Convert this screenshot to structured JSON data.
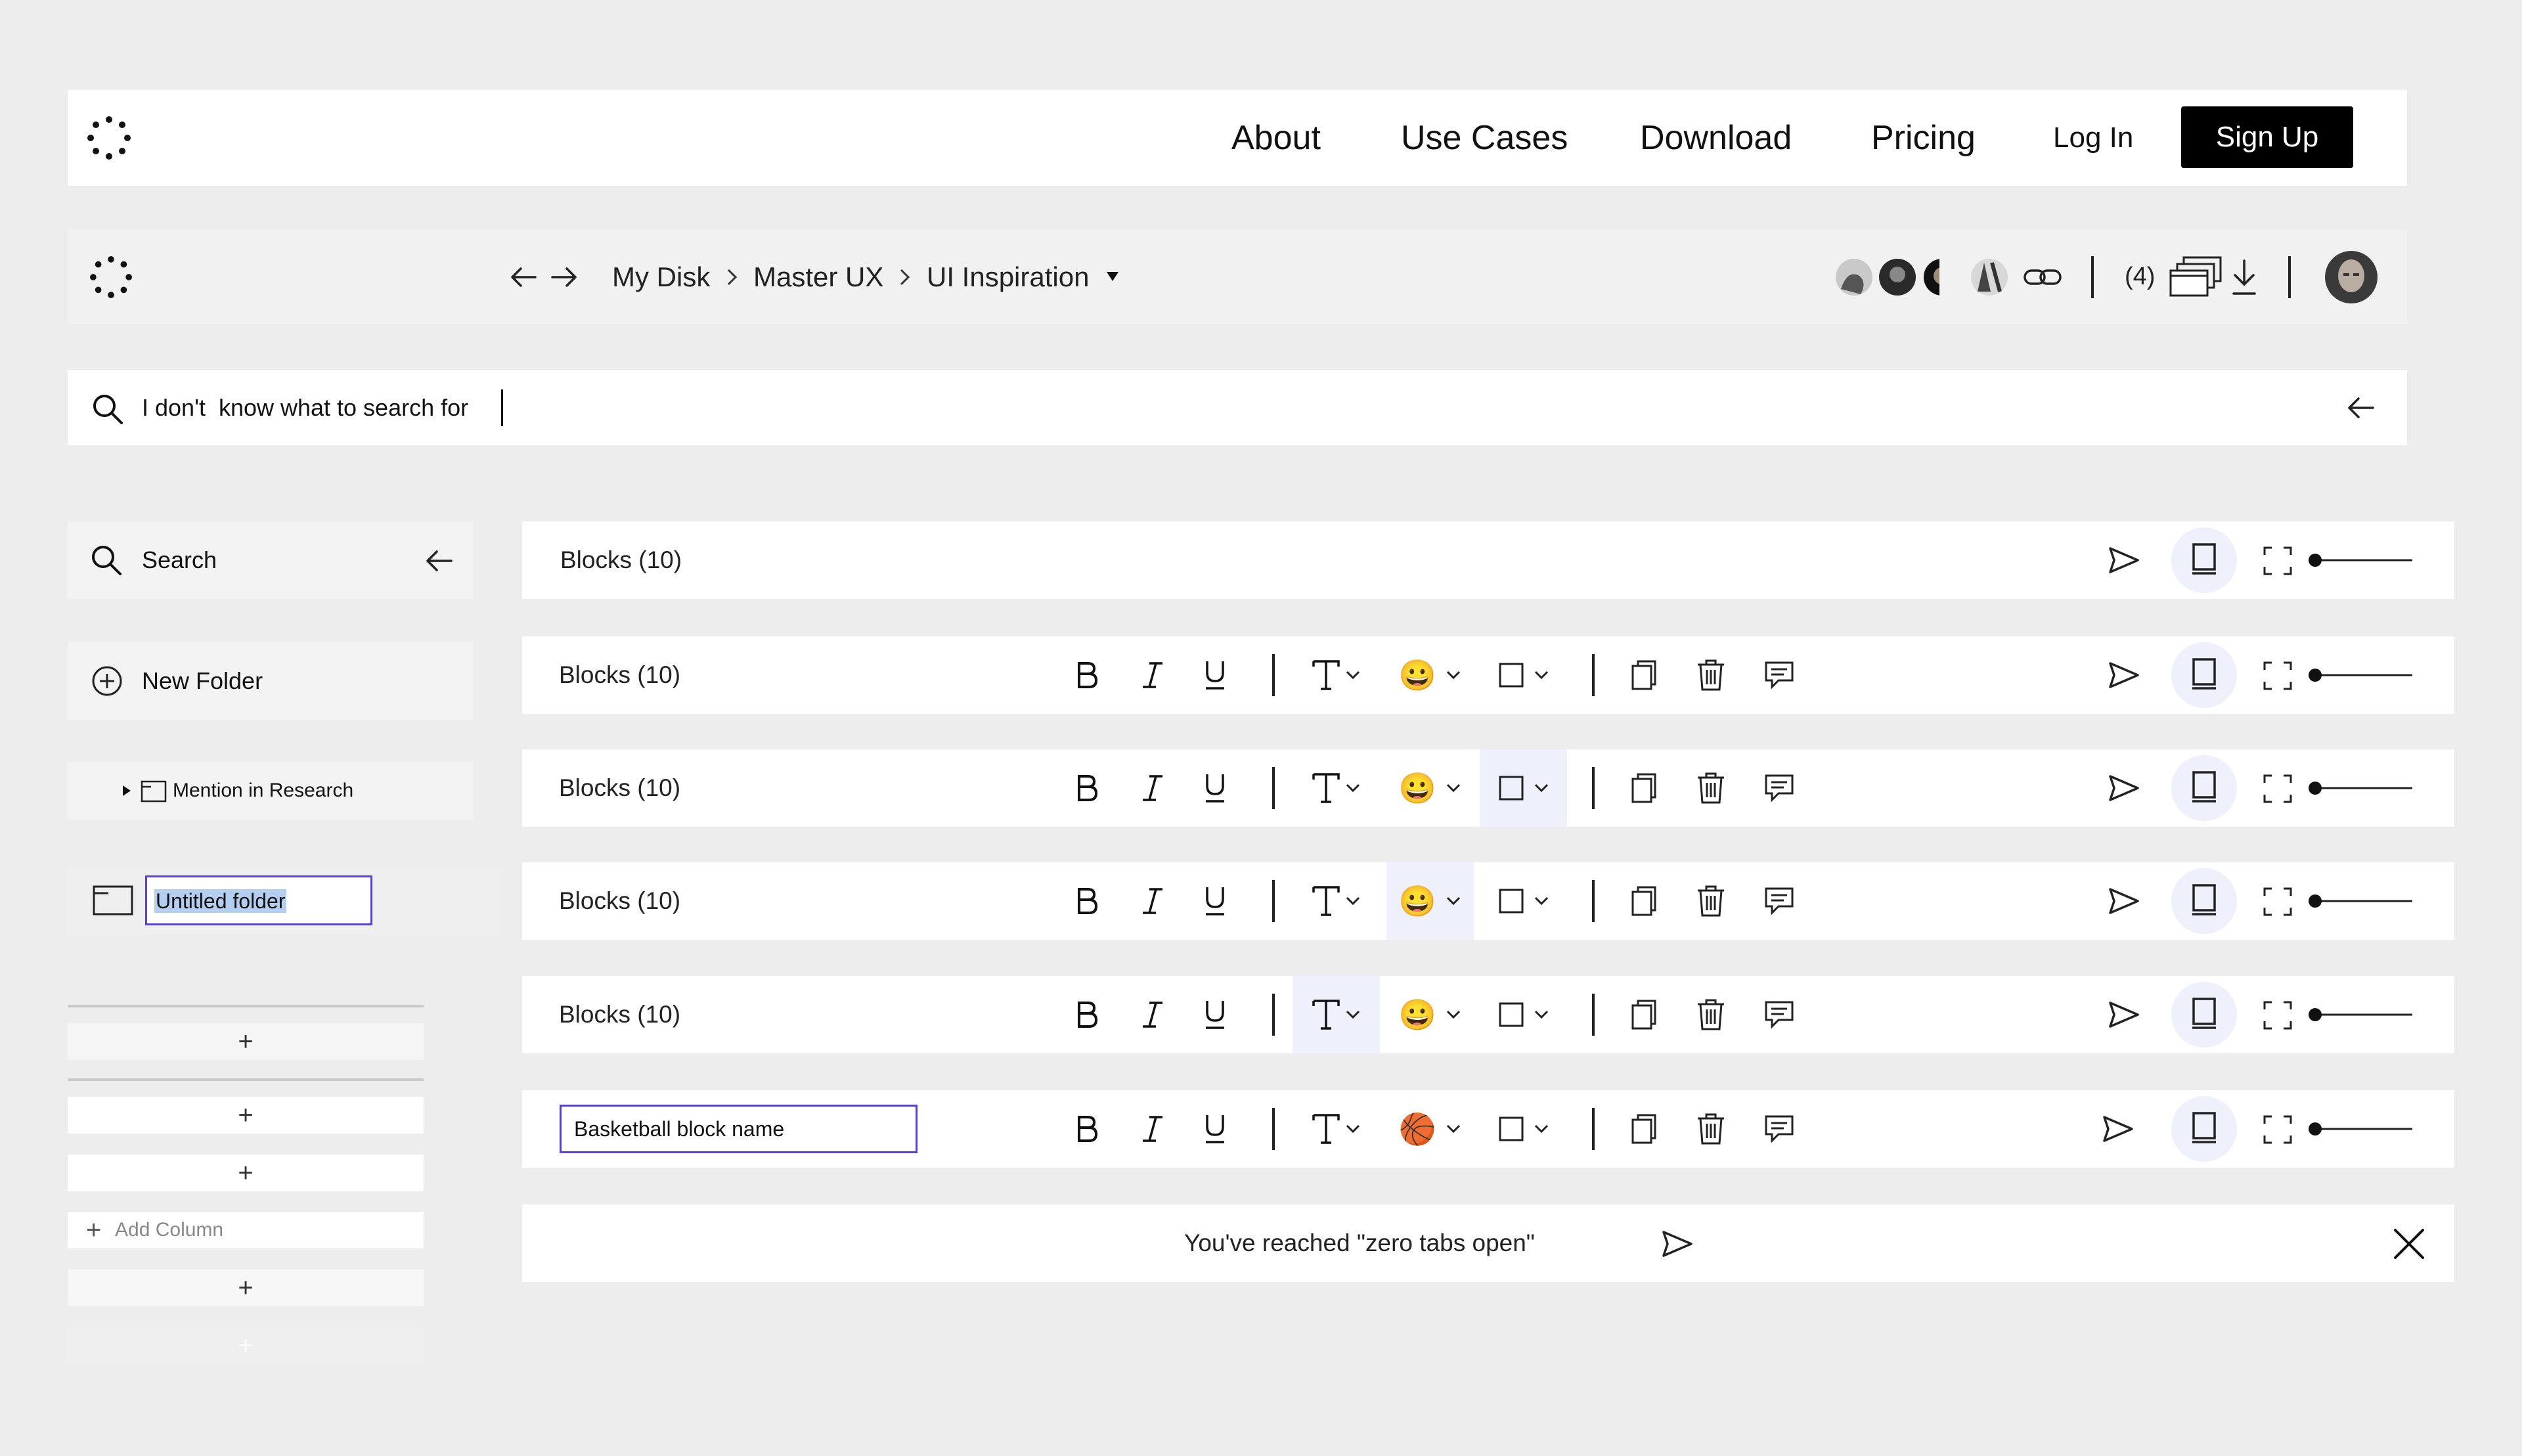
{
  "nav": {
    "links": [
      "About",
      "Use Cases",
      "Download",
      "Pricing"
    ],
    "login": "Log In",
    "signup": "Sign Up"
  },
  "crumbs": {
    "items": [
      "My Disk",
      "Master UX",
      "UI Inspiration"
    ],
    "count": "(4)"
  },
  "search": {
    "query": "I don't  know what to search for"
  },
  "sidebar": {
    "search_label": "Search",
    "new_folder_label": "New Folder",
    "folder_item": "Mention in Research",
    "new_folder_input": "Untitled folder",
    "add_column": "Add Column",
    "plus": "+"
  },
  "blocks": {
    "label": "Blocks (10)",
    "editing_name": "Basketball block name",
    "emoji_default": "😀",
    "emoji_basketball": "🏀"
  },
  "footer": {
    "message": "You've reached \"zero tabs open\""
  },
  "colors": {
    "accent": "#5b3fd9",
    "highlight": "#eef0fc",
    "button_bg": "#000000"
  }
}
